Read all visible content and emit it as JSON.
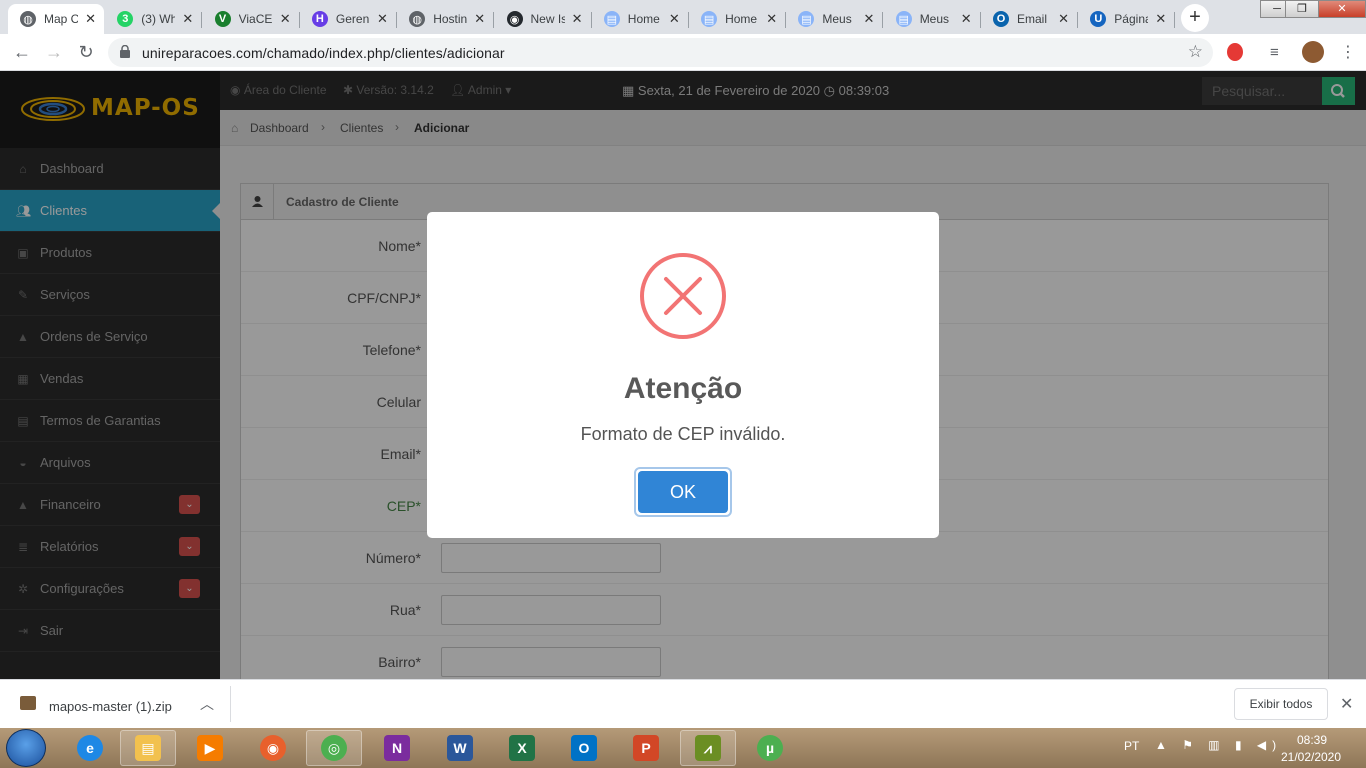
{
  "browser": {
    "tabs": [
      {
        "label": "Map C",
        "icon": "globe-icon",
        "color": "#5f6368",
        "active": true
      },
      {
        "label": "(3) Wh",
        "icon": "whatsapp-icon",
        "color": "#25d366"
      },
      {
        "label": "ViaCEP",
        "icon": "viacep-icon",
        "color": "#1a7f2e"
      },
      {
        "label": "Geren",
        "icon": "hostinger-icon",
        "color": "#673de6"
      },
      {
        "label": "Hostin",
        "icon": "globe-icon",
        "color": "#5f6368"
      },
      {
        "label": "New Is",
        "icon": "github-icon",
        "color": "#24292e"
      },
      {
        "label": "Home",
        "icon": "doc-icon",
        "color": "#8ab4f8"
      },
      {
        "label": "Home",
        "icon": "doc-icon",
        "color": "#8ab4f8"
      },
      {
        "label": "Meus",
        "icon": "doc-icon",
        "color": "#8ab4f8"
      },
      {
        "label": "Meus",
        "icon": "doc-icon",
        "color": "#8ab4f8"
      },
      {
        "label": "Email",
        "icon": "outlook-icon",
        "color": "#0a64ad"
      },
      {
        "label": "Página",
        "icon": "uv-icon",
        "color": "#1565c0"
      }
    ],
    "new_tab": "+",
    "url": "unireparacoes.com/chamado/index.php/clientes/adicionar"
  },
  "app": {
    "logo": "MAP-OS",
    "sidebar": [
      {
        "label": "Dashboard",
        "icon": "home-icon"
      },
      {
        "label": "Clientes",
        "icon": "users-icon",
        "active": true
      },
      {
        "label": "Produtos",
        "icon": "box-icon"
      },
      {
        "label": "Serviços",
        "icon": "wrench-icon"
      },
      {
        "label": "Ordens de Serviço",
        "icon": "tag-icon"
      },
      {
        "label": "Vendas",
        "icon": "cart-icon"
      },
      {
        "label": "Termos de Garantias",
        "icon": "document-icon"
      },
      {
        "label": "Arquivos",
        "icon": "hdd-icon"
      },
      {
        "label": "Financeiro",
        "icon": "money-icon",
        "caret": true
      },
      {
        "label": "Relatórios",
        "icon": "list-icon",
        "caret": true
      },
      {
        "label": "Configurações",
        "icon": "cog-icon",
        "caret": true
      },
      {
        "label": "Sair",
        "icon": "logout-icon"
      }
    ],
    "topbar": {
      "client_area": "Área do Cliente",
      "version": "Versão: 3.14.2",
      "user": "Admin",
      "date": "Sexta, 21 de Fevereiro de 2020",
      "time": "08:39:03",
      "search_placeholder": "Pesquisar..."
    },
    "breadcrumb": [
      "Dashboard",
      "Clientes",
      "Adicionar"
    ],
    "form": {
      "title": "Cadastro de Cliente",
      "fields": [
        "Nome*",
        "CPF/CNPJ*",
        "Telefone*",
        "Celular",
        "Email*",
        "CEP*",
        "Número*",
        "Rua*",
        "Bairro*"
      ]
    },
    "dialog": {
      "title": "Atenção",
      "message": "Formato de CEP inválido.",
      "button": "OK",
      "icon_color": "#f27474",
      "button_color": "#3085d6"
    }
  },
  "downloads": {
    "file": "mapos-master (1).zip",
    "show_all": "Exibir todos"
  },
  "taskbar": {
    "apps": [
      "ie-icon",
      "explorer-icon",
      "media-icon",
      "firefox-icon",
      "chrome-icon",
      "onenote-icon",
      "word-icon",
      "excel-icon",
      "outlook-icon",
      "powerpoint-icon",
      "charts-icon",
      "utorrent-icon"
    ],
    "lang": "PT",
    "time": "08:39",
    "date": "21/02/2020"
  }
}
